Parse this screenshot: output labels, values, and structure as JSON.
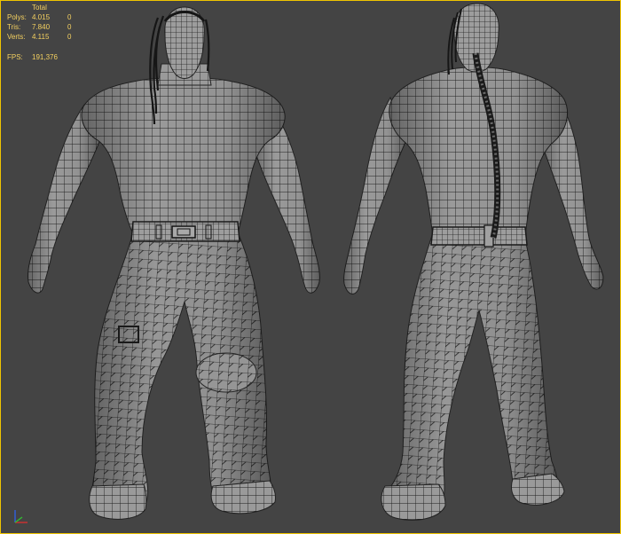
{
  "viewport": {
    "background": "#444444",
    "border_color": "#f0c400",
    "mode": "wireframe over shaded"
  },
  "stats": {
    "header": "Total",
    "rows": [
      {
        "label": "Polys:",
        "total": "4.015",
        "selected": "0"
      },
      {
        "label": "Tris:",
        "total": "7.840",
        "selected": "0"
      },
      {
        "label": "Verts:",
        "total": "4.115",
        "selected": "0"
      }
    ],
    "fps_label": "FPS:",
    "fps_value": "191,376",
    "text_color": "#f4d060"
  },
  "models": [
    {
      "name": "character-front-view",
      "skin_color": "#9a9a9a",
      "wire_color": "#1e1e1e"
    },
    {
      "name": "character-back-view",
      "skin_color": "#9a9a9a",
      "wire_color": "#1e1e1e"
    }
  ],
  "axis_gizmo": {
    "icons": [
      "x-axis-icon",
      "y-axis-icon",
      "z-axis-icon"
    ],
    "colors": {
      "x": "#d03030",
      "y": "#30c030",
      "z": "#3060e0"
    }
  }
}
